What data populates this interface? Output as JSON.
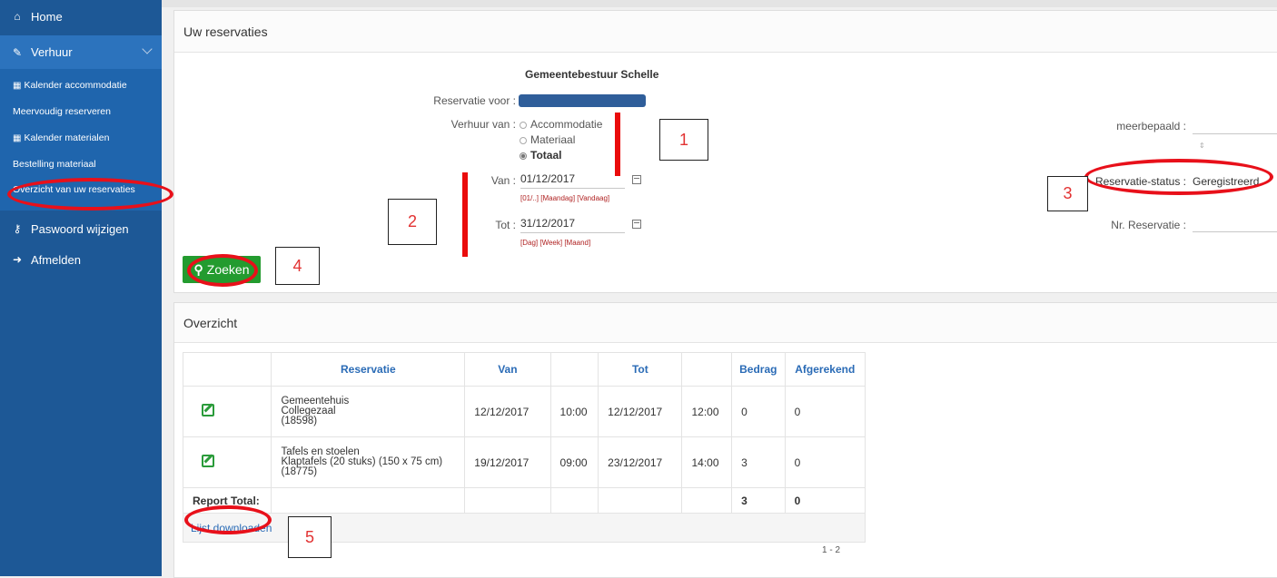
{
  "sidebar": {
    "home": "Home",
    "verhuur": "Verhuur",
    "subitems": [
      "Kalender accommodatie",
      "Meervoudig reserveren",
      "Kalender materialen",
      "Bestelling materiaal",
      "Overzicht van uw reservaties"
    ],
    "paswoord": "Paswoord wijzigen",
    "afmelden": "Afmelden"
  },
  "search_panel": {
    "title": "Uw reservaties",
    "org": "Gemeentebestuur Schelle",
    "reservatie_voor_label": "Reservatie voor :",
    "verhuur_van_label": "Verhuur van :",
    "radio_options": [
      "Accommodatie",
      "Materiaal",
      "Totaal"
    ],
    "selected_radio": "Totaal",
    "van_label": "Van :",
    "van_value": "01/12/2017",
    "van_hint": "[01/..] [Maandag] [Vandaag]",
    "tot_label": "Tot :",
    "tot_value": "31/12/2017",
    "tot_hint": "[Dag] [Week] [Maand]",
    "meerbepaald_label": "meerbepaald :",
    "spinner_glyph": "⇕",
    "status_label": "Reservatie-status :",
    "status_value": "Geregistreerd",
    "nr_label": "Nr. Reservatie :",
    "zoeken_label": "Zoeken"
  },
  "overview": {
    "title": "Overzicht",
    "headers": [
      "",
      "Reservatie",
      "Van",
      "",
      "Tot",
      "",
      "Bedrag",
      "Afgerekend"
    ],
    "rows": [
      {
        "reservatie": [
          "Gemeentehuis",
          "Collegezaal",
          "(18598)"
        ],
        "van": "12/12/2017",
        "van_time": "10:00",
        "tot": "12/12/2017",
        "tot_time": "12:00",
        "bedrag": "0",
        "afgerekend": "0"
      },
      {
        "reservatie": [
          "Tafels en stoelen",
          "Klaptafels (20 stuks) (150 x 75 cm)",
          "(18775)"
        ],
        "van": "19/12/2017",
        "van_time": "09:00",
        "tot": "23/12/2017",
        "tot_time": "14:00",
        "bedrag": "3",
        "afgerekend": "0"
      }
    ],
    "total_label": "Report Total:",
    "total_bedrag": "3",
    "total_afgerekend": "0",
    "download_label": "Lijst downloaden",
    "pager": "1 - 2"
  },
  "annotations": {
    "labels": [
      "1",
      "2",
      "3",
      "4",
      "5"
    ],
    "color": "#e8101a"
  }
}
